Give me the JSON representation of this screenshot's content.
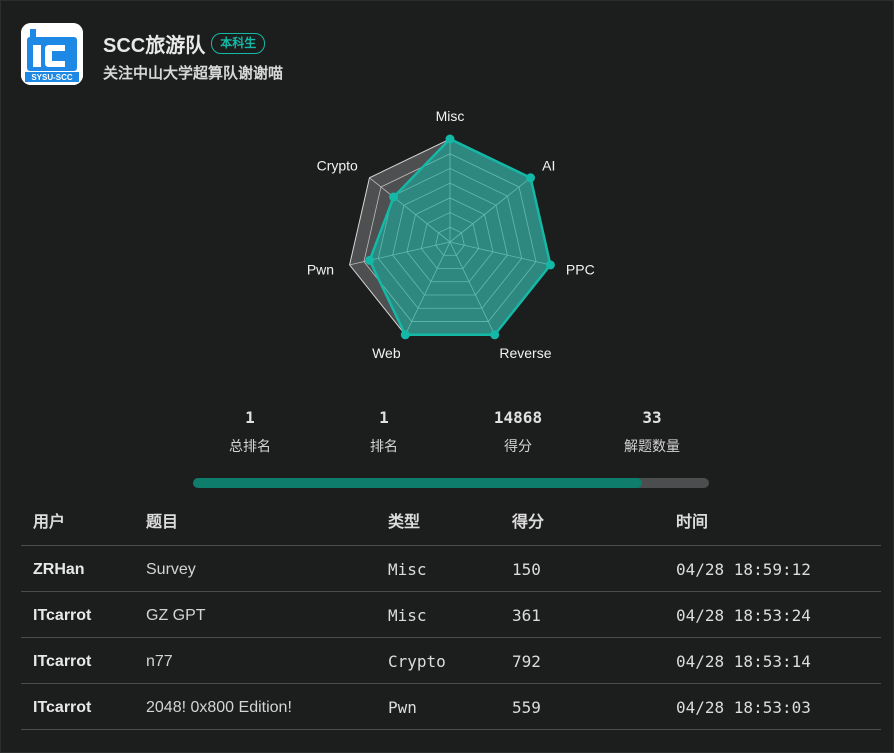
{
  "team": {
    "name": "SCC旅游队",
    "badge": "本科生",
    "motto": "关注中山大学超算队谢谢喵",
    "logo_text": "SYSU-SCC",
    "logo_mark": "iC"
  },
  "radar": {
    "axes": [
      "Misc",
      "AI",
      "PPC",
      "Reverse",
      "Web",
      "Pwn",
      "Crypto"
    ],
    "values": [
      1.0,
      1.0,
      1.0,
      1.0,
      1.0,
      0.8,
      0.7
    ],
    "max": 1.0,
    "rings": 7,
    "fill_color": "#14b8a6"
  },
  "stats": [
    {
      "value": "1",
      "label": "总排名"
    },
    {
      "value": "1",
      "label": "排名"
    },
    {
      "value": "14868",
      "label": "得分"
    },
    {
      "value": "33",
      "label": "解题数量"
    }
  ],
  "progress": {
    "fraction": 0.87,
    "color": "#0f7d6c"
  },
  "table": {
    "headers": {
      "user": "用户",
      "title": "题目",
      "type": "类型",
      "score": "得分",
      "time": "时间"
    },
    "rows": [
      {
        "user": "ZRHan",
        "title": "Survey",
        "type": "Misc",
        "score": "150",
        "time": "04/28 18:59:12"
      },
      {
        "user": "ITcarrot",
        "title": "GZ GPT",
        "type": "Misc",
        "score": "361",
        "time": "04/28 18:53:24"
      },
      {
        "user": "ITcarrot",
        "title": "n77",
        "type": "Crypto",
        "score": "792",
        "time": "04/28 18:53:14"
      },
      {
        "user": "ITcarrot",
        "title": "2048! 0x800 Edition!",
        "type": "Pwn",
        "score": "559",
        "time": "04/28 18:53:03"
      }
    ]
  }
}
